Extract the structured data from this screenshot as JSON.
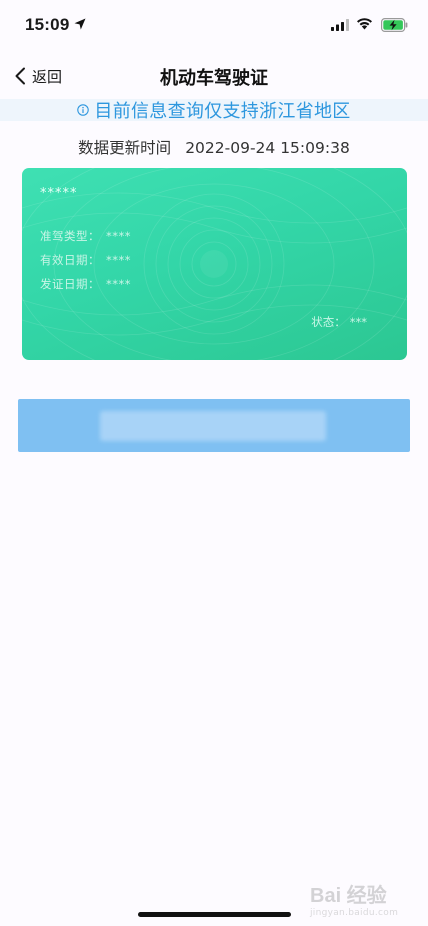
{
  "status_bar": {
    "time": "15:09",
    "icons": [
      "location-arrow-icon",
      "signal-icon",
      "wifi-icon",
      "battery-charging-icon"
    ]
  },
  "nav": {
    "back_label": "返回",
    "title": "机动车驾驶证",
    "back_icon": "chevron-left-icon"
  },
  "notice": {
    "icon": "info-circle-icon",
    "text": "目前信息查询仅支持浙江省地区",
    "color": "#2e97de"
  },
  "update": {
    "label": "数据更新时间",
    "timestamp": "2022-09-24 15:09:38"
  },
  "license_card": {
    "name": "*****",
    "fields": [
      {
        "label": "准驾类型：",
        "value": "****"
      },
      {
        "label": "有效日期：",
        "value": "****"
      },
      {
        "label": "发证日期：",
        "value": "****"
      }
    ],
    "status_label": "状态：",
    "status_value": "***",
    "colors": {
      "from": "#3fe0b3",
      "to": "#2cc792"
    }
  },
  "action_button": {
    "color": "#7fc0f2"
  },
  "watermark": {
    "main": "Bai 经验",
    "sub": "jingyan.baidu.com"
  }
}
